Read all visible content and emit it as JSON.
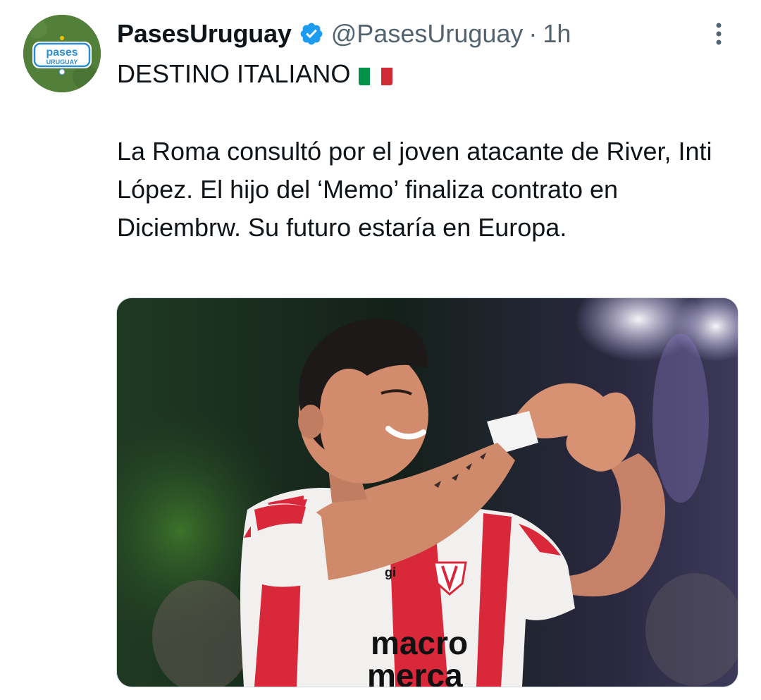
{
  "author": {
    "display_name": "PasesUruguay",
    "handle": "@PasesUruguay",
    "separator": "·",
    "time": "1h",
    "verified": true,
    "avatar_text_line1": "pases",
    "avatar_text_line2": "URUGUAY"
  },
  "tweet": {
    "headline": "DESTINO ITALIANO",
    "headline_emoji": "italy-flag",
    "body": "La Roma consultó por el joven atacante de River, Inti López. El hijo del ‘Memo’ finaliza contrato en Diciembrw. Su futuro estaría en Europa."
  },
  "media": {
    "jersey_sponsor_line1": "macro",
    "jersey_sponsor_line2": "merca",
    "jersey_brand": "gi"
  },
  "colors": {
    "verified_badge": "#1d9bf0",
    "text_primary": "#0f1419",
    "text_secondary": "#536471",
    "flag_green": "#009246",
    "flag_white": "#ffffff",
    "flag_red": "#ce2b37",
    "jersey_red": "#d8283a"
  },
  "icons": {
    "more": "more-vertical-icon",
    "verified": "verified-badge-icon"
  }
}
